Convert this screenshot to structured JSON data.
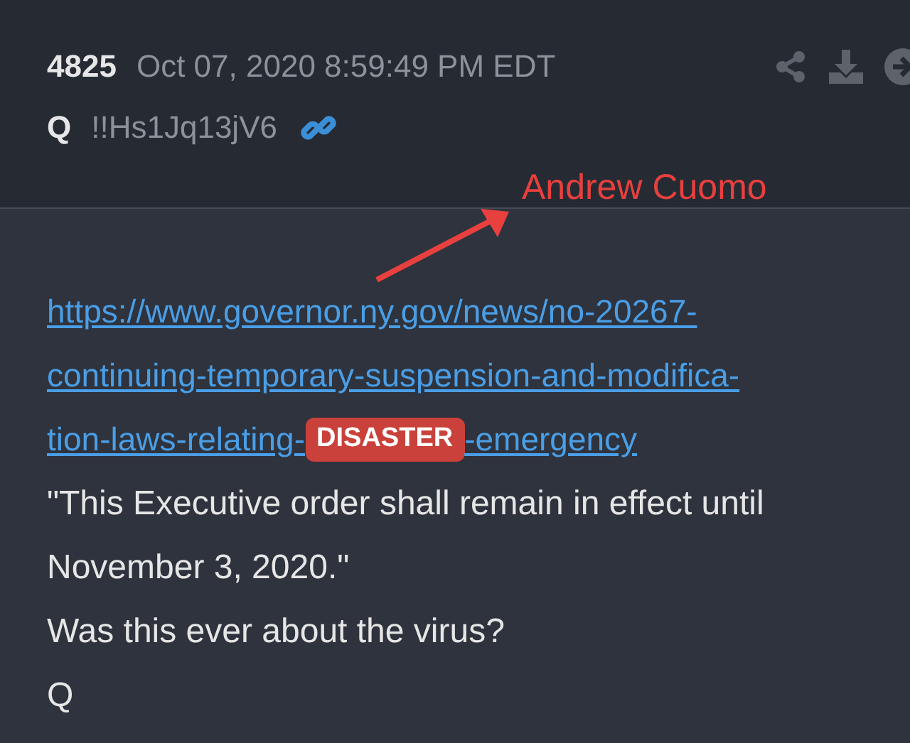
{
  "post": {
    "number": "4825",
    "date": "Oct 07, 2020 8:59:49 PM EDT",
    "author": "Q",
    "tripcode": "!!Hs1Jq13jV6"
  },
  "annotation": {
    "label": "Andrew Cuomo"
  },
  "link_lines": [
    {
      "text": "https://www.governor.ny.gov/news/no-20267-"
    },
    {
      "text": "continuing-temporary-suspension-and-modifica-"
    },
    {
      "text": "tion-laws-relating-",
      "badge": "DISASTER",
      "after": "-emergency"
    }
  ],
  "body_lines": [
    "\"This Executive order shall remain in effect until November 3, 2020.\"",
    "Was this ever about the virus?",
    "Q"
  ]
}
